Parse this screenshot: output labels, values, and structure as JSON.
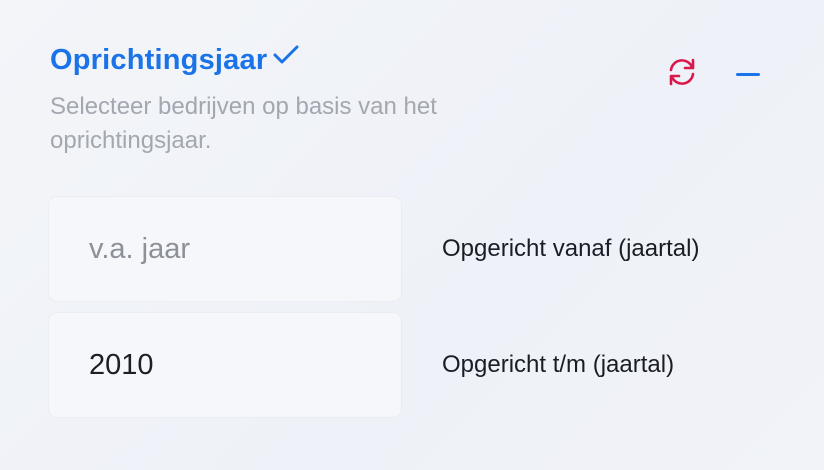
{
  "filter": {
    "title": "Oprichtingsjaar",
    "description": "Selecteer bedrijven op basis van het oprichtingsjaar.",
    "accent_color": "#1a73e8",
    "reset_color": "#d9184b",
    "icons": {
      "title_status": "check-icon",
      "reset": "reset-icon",
      "collapse": "minus-icon"
    },
    "fields": {
      "from": {
        "value": "",
        "placeholder": "v.a. jaar",
        "label": "Opgericht vanaf (jaartal)"
      },
      "to": {
        "value": "2010",
        "placeholder": "",
        "label": "Opgericht t/m (jaartal)"
      }
    }
  }
}
